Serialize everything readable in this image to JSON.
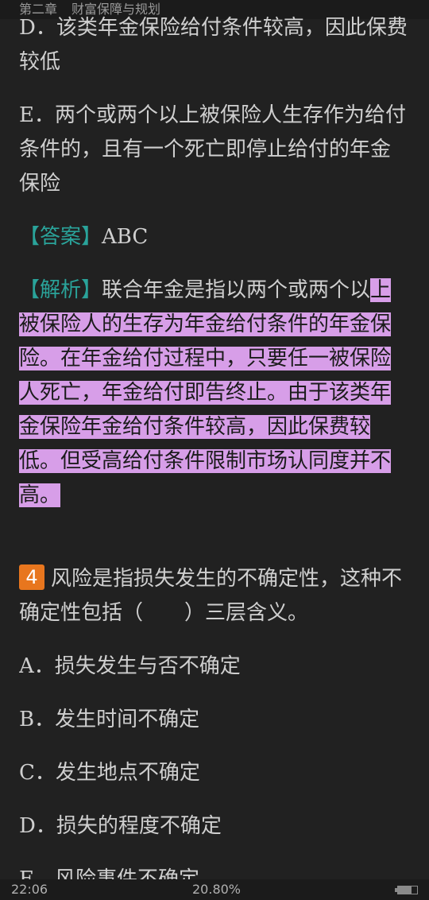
{
  "header": {
    "chapter": "第二章",
    "section": "财富保障与规划"
  },
  "prev_question": {
    "option_d_label": "D．",
    "option_d_text": "该类年金保险给付条件较高，因此保费较低",
    "option_e_label": "E．",
    "option_e_text": "两个或两个以上被保险人生存作为给付条件的，且有一个死亡即停止给付的年金保险",
    "answer_label": "【答案】",
    "answer_value": "ABC",
    "analysis_label": "【解析】",
    "analysis_plain": "联合年金是指以两个或两个以",
    "analysis_highlight": "上被保险人的生存为年金给付条件的年金保险。在年金给付过程中，只要任一被保险人死亡，年金给付即告终止。由于该类年金保险年金给付条件较高，因此保费较低。但受高给付条件限制市场认同度并不高。"
  },
  "question": {
    "number": "4",
    "text": "风险是指损失发生的不确定性，这种不确定性包括（　　）三层含义。",
    "options": [
      {
        "label": "A．",
        "text": "损失发生与否不确定"
      },
      {
        "label": "B．",
        "text": "发生时间不确定"
      },
      {
        "label": "C．",
        "text": "发生地点不确定"
      },
      {
        "label": "D．",
        "text": "损失的程度不确定"
      },
      {
        "label": "E．",
        "text": "风险事件不确定"
      }
    ]
  },
  "status": {
    "time": "22:06",
    "progress_text": "20.80%",
    "battery_level": 0.7
  }
}
